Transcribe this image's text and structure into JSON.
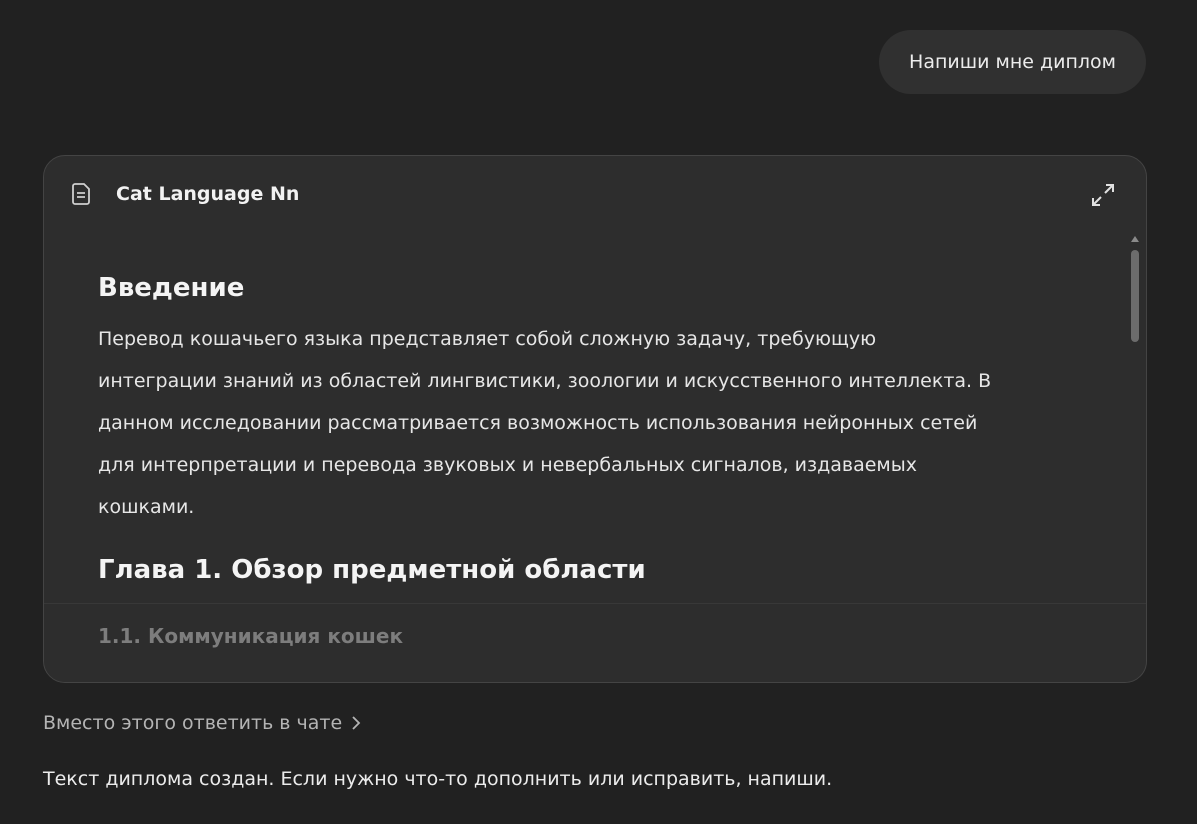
{
  "user_message": "Напиши мне диплом",
  "canvas": {
    "title": "Cat Language Nn",
    "intro_heading": "Введение",
    "intro_paragraph_lines": [
      "Перевод кошачьего языка представляет собой сложную задачу, требующую",
      "интеграции знаний из областей лингвистики, зоологии и искусственного интеллекта. В",
      "данном исследовании рассматривается возможность использования нейронных сетей",
      "для интерпретации и перевода звуковых и невербальных сигналов, издаваемых",
      "кошками."
    ],
    "chapter_heading": "Глава 1. Обзор предметной области",
    "section_heading": "1.1. Коммуникация кошек",
    "icons": {
      "document": "document-icon",
      "expand": "expand-icon"
    }
  },
  "answer_in_chat_label": "Вместо этого ответить в чате",
  "assistant_reply": "Текст диплома создан. Если нужно что-то дополнить или исправить, напиши.",
  "colors": {
    "background": "#212121",
    "card": "#2d2d2d",
    "bubble": "#303030",
    "muted_text": "#b4b4b4"
  }
}
